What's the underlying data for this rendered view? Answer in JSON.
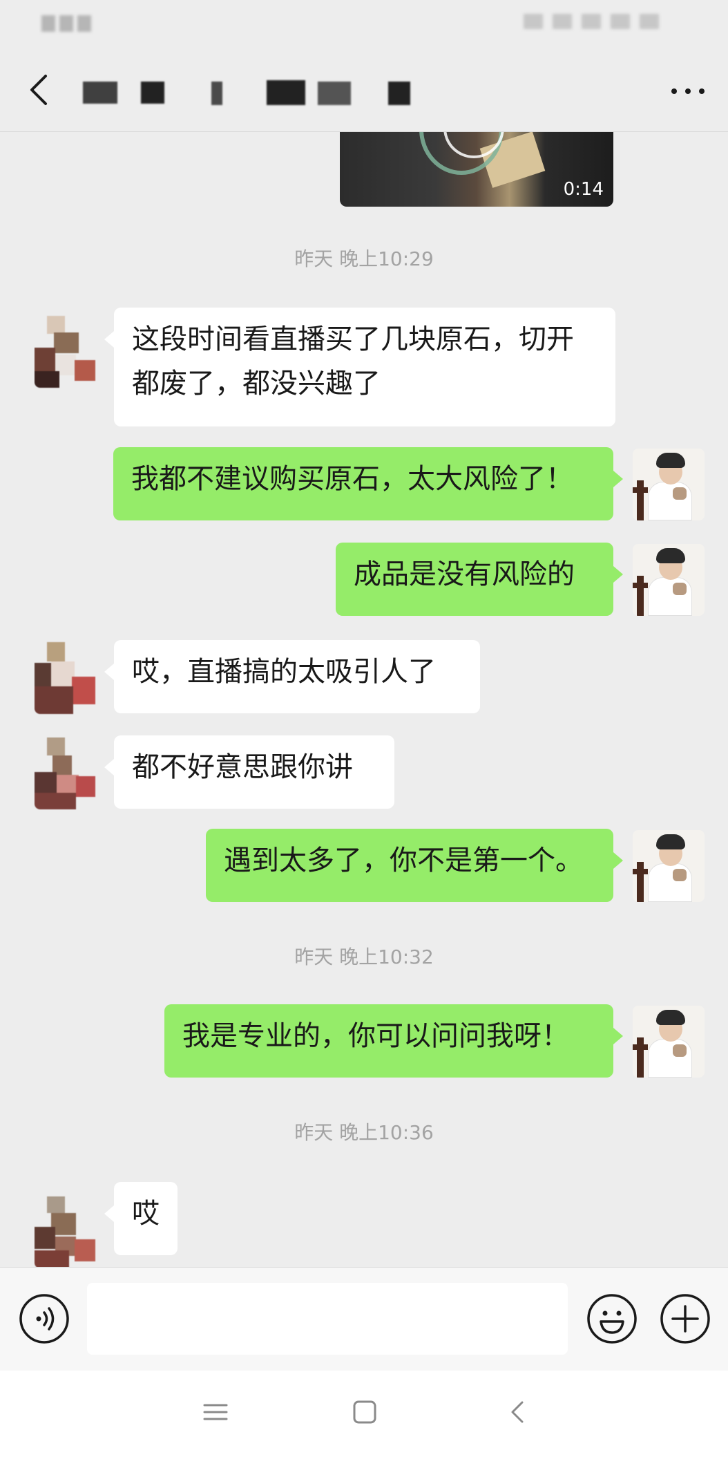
{
  "header": {
    "contact_name": ""
  },
  "video": {
    "duration": "0:14"
  },
  "messages": [
    {
      "type": "timestamp",
      "text": "昨天 晚上10:29"
    },
    {
      "type": "in",
      "text": "这段时间看直播买了几块原石，切开都废了，都没兴趣了"
    },
    {
      "type": "out",
      "text": "我都不建议购买原石，太大风险了！"
    },
    {
      "type": "out",
      "text": "成品是没有风险的"
    },
    {
      "type": "in",
      "text": "哎，直播搞的太吸引人了"
    },
    {
      "type": "in",
      "text": "都不好意思跟你讲"
    },
    {
      "type": "out",
      "text": "遇到太多了，你不是第一个。"
    },
    {
      "type": "timestamp",
      "text": "昨天 晚上10:32"
    },
    {
      "type": "out",
      "text": "我是专业的，你可以问问我呀！"
    },
    {
      "type": "timestamp",
      "text": "昨天 晚上10:36"
    },
    {
      "type": "in",
      "text": "哎"
    }
  ],
  "input": {
    "value": "",
    "placeholder": ""
  },
  "icons": {
    "back": "chevron-left-icon",
    "more": "more-dots-icon",
    "voice": "voice-icon",
    "emoji": "emoji-icon",
    "plus": "plus-icon",
    "menu": "menu-icon",
    "home": "home-icon",
    "sys_back": "system-back-icon"
  },
  "colors": {
    "background": "#ededed",
    "outgoing_bubble": "#95ec69",
    "incoming_bubble": "#ffffff",
    "timestamp_text": "#a3a3a3"
  }
}
